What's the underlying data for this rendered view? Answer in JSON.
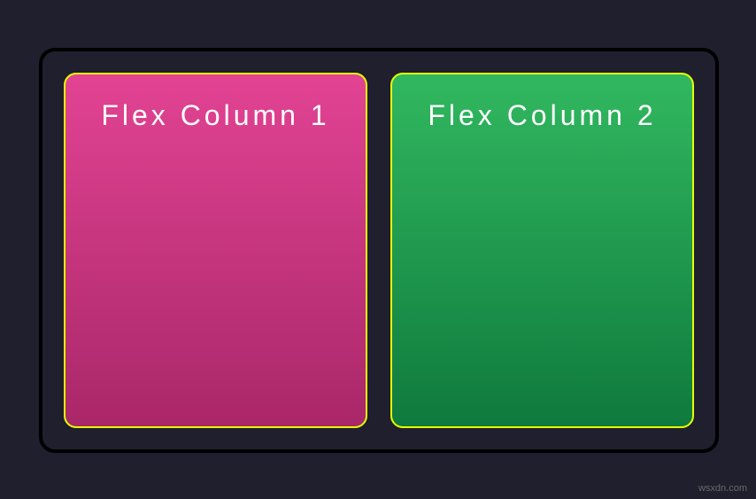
{
  "columns": [
    {
      "title": "Flex Column 1"
    },
    {
      "title": "Flex Column 2"
    }
  ],
  "watermark": "wsxdn.com"
}
